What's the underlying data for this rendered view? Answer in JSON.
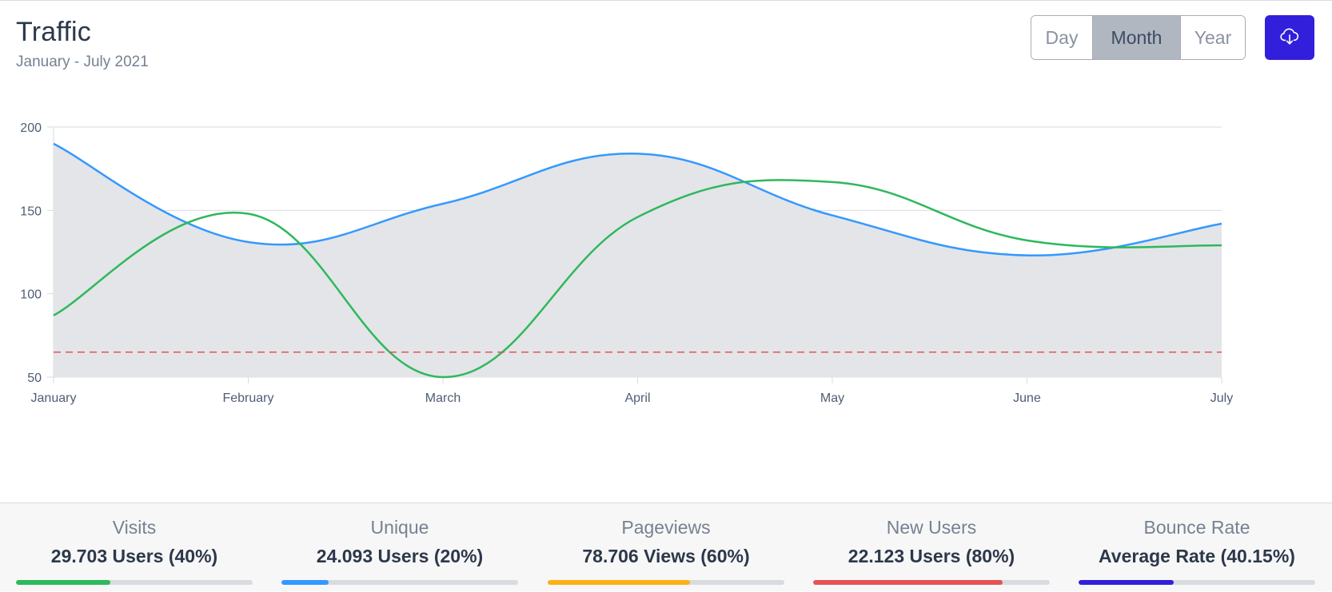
{
  "header": {
    "title": "Traffic",
    "subtitle": "January - July 2021"
  },
  "toolbar": {
    "range_options": [
      "Day",
      "Month",
      "Year"
    ],
    "selected_range": "Month",
    "download_icon": "cloud-download-icon",
    "accent_color": "#321fdb"
  },
  "chart_data": {
    "type": "line",
    "categories": [
      "January",
      "February",
      "March",
      "April",
      "May",
      "June",
      "July"
    ],
    "ylim": [
      50,
      200
    ],
    "yticks": [
      50,
      100,
      150,
      200
    ],
    "grid": true,
    "series": [
      {
        "values": [
          190,
          131,
          154,
          184,
          147,
          123,
          142
        ],
        "color": "#3399ff",
        "fill": "#e4e5e8"
      },
      {
        "values": [
          87,
          148,
          50,
          146,
          167,
          132,
          129
        ],
        "color": "#2eb85c"
      }
    ],
    "threshold": {
      "value": 65,
      "color": "#e55353",
      "style": "dashed"
    }
  },
  "stats": [
    {
      "label": "Visits",
      "value": "29.703 Users (40%)",
      "percent": 40,
      "color": "#2eb85c"
    },
    {
      "label": "Unique",
      "value": "24.093 Users (20%)",
      "percent": 20,
      "color": "#3399ff"
    },
    {
      "label": "Pageviews",
      "value": "78.706 Views (60%)",
      "percent": 60,
      "color": "#f9b115"
    },
    {
      "label": "New Users",
      "value": "22.123 Users (80%)",
      "percent": 80,
      "color": "#e55353"
    },
    {
      "label": "Bounce Rate",
      "value": "Average Rate (40.15%)",
      "percent": 40.15,
      "color": "#321fdb"
    }
  ]
}
